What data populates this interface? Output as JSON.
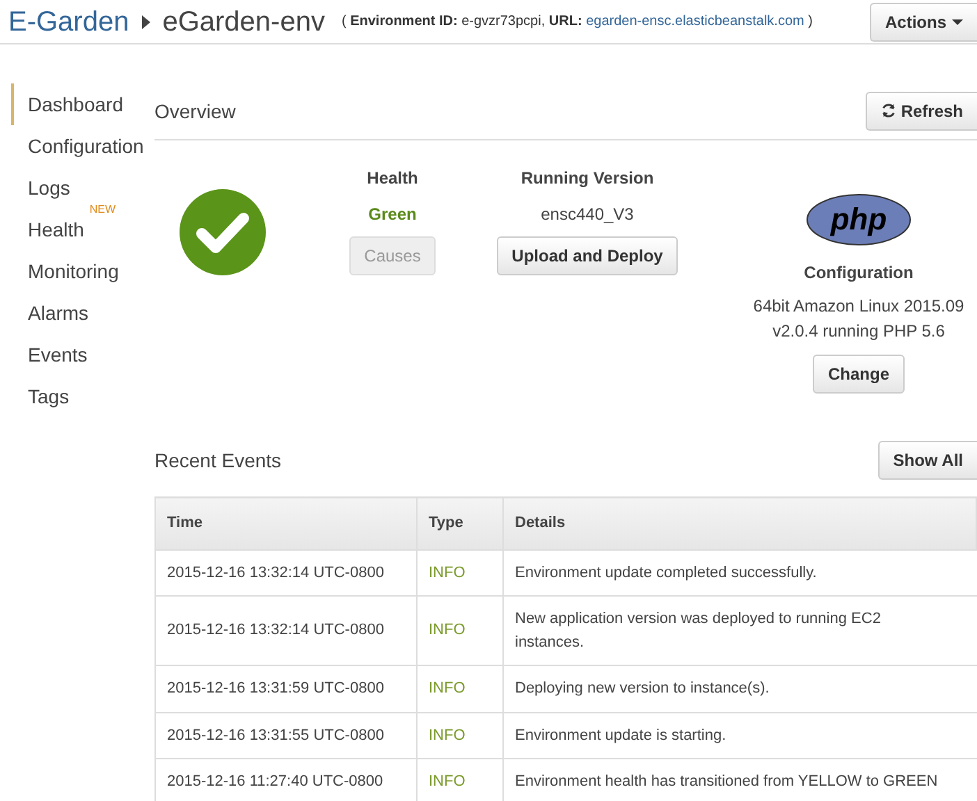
{
  "header": {
    "open": "(",
    "close": ")",
    "app": "E-Garden",
    "environment": "eGarden-env",
    "id_label": "Environment ID:",
    "id_value": "e-gvzr73pcpi,",
    "url_label": "URL:",
    "url": "egarden-ensc.elasticbeanstalk.com",
    "actions": "Actions"
  },
  "sidebar": {
    "items": [
      {
        "label": "Dashboard",
        "selected": true
      },
      {
        "label": "Configuration",
        "selected": false
      },
      {
        "label": "Logs",
        "selected": false
      },
      {
        "label": "Health",
        "selected": false,
        "badge": "NEW"
      },
      {
        "label": "Monitoring",
        "selected": false
      },
      {
        "label": "Alarms",
        "selected": false
      },
      {
        "label": "Events",
        "selected": false
      },
      {
        "label": "Tags",
        "selected": false
      }
    ]
  },
  "overview": {
    "title": "Overview",
    "refresh": "Refresh",
    "health": {
      "label": "Health",
      "value": "Green",
      "color": "#5a8a1a",
      "causes": {
        "label": "Causes",
        "disabled": true
      }
    },
    "version": {
      "label": "Running Version",
      "value": "ensc440_V3",
      "button": {
        "label": "Upload and Deploy",
        "disabled": false
      }
    },
    "configuration": {
      "logo_text": "php",
      "label": "Configuration",
      "lines": [
        "64bit Amazon Linux 2015.09",
        "v2.0.4 running PHP 5.6"
      ],
      "button": {
        "label": "Change",
        "disabled": false
      }
    }
  },
  "events": {
    "title": "Recent Events",
    "show_all": "Show All",
    "table": {
      "columns": [
        "Time",
        "Type",
        "Details"
      ],
      "rows": [
        [
          "2015-12-16 13:32:14 UTC-0800",
          "INFO",
          "Environment update completed successfully."
        ],
        [
          "2015-12-16 13:32:14 UTC-0800",
          "INFO",
          "New application version was deployed to running EC2 instances."
        ],
        [
          "2015-12-16 13:31:59 UTC-0800",
          "INFO",
          "Deploying new version to instance(s)."
        ],
        [
          "2015-12-16 13:31:55 UTC-0800",
          "INFO",
          "Environment update is starting."
        ],
        [
          "2015-12-16 11:27:40 UTC-0800",
          "INFO",
          "Environment health has transitioned from YELLOW to GREEN"
        ]
      ]
    }
  }
}
